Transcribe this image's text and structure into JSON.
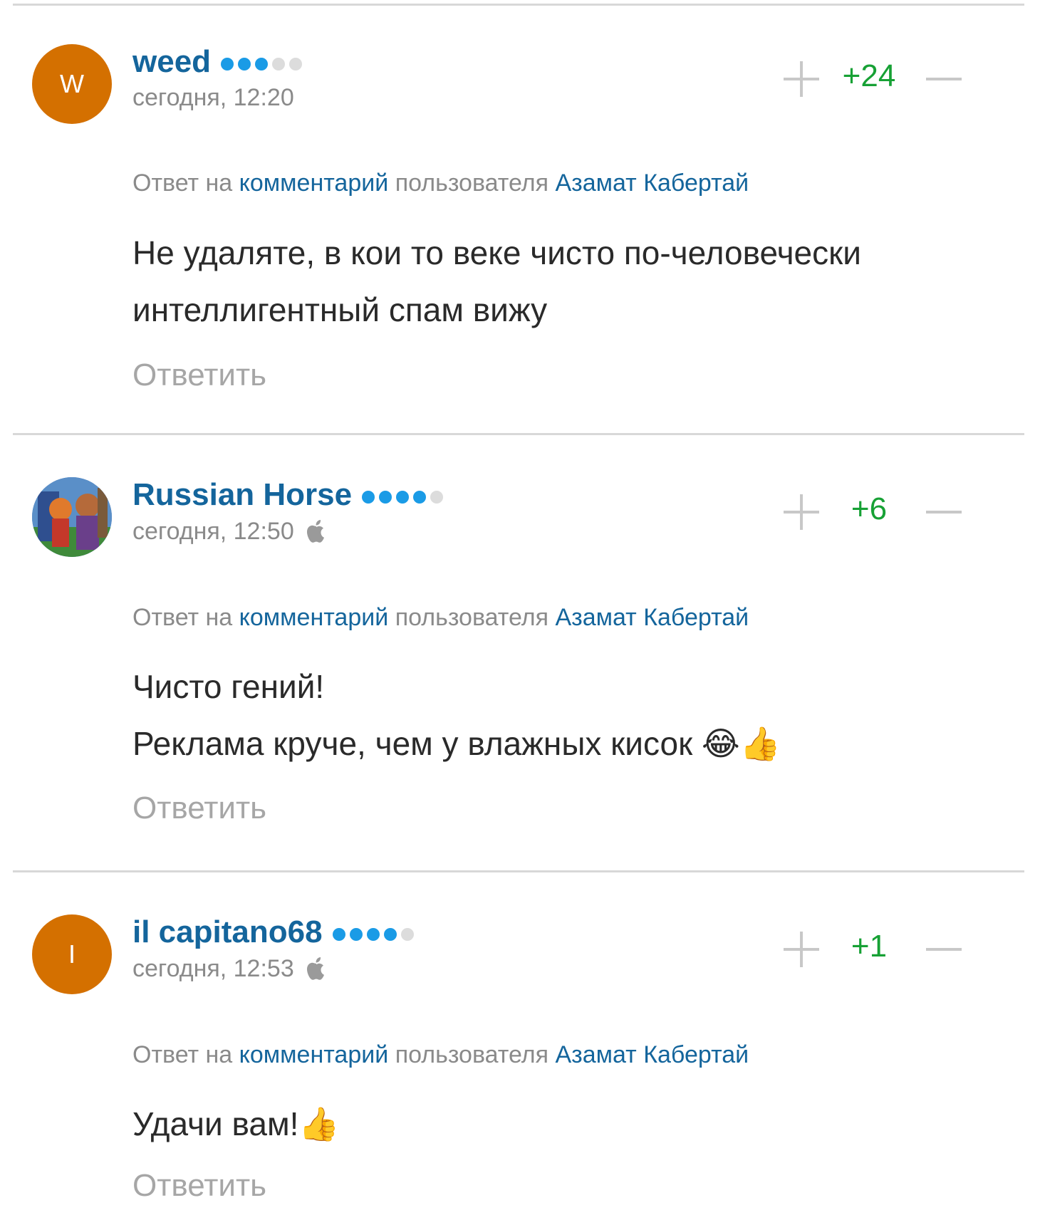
{
  "comments": [
    {
      "avatar_letter": "W",
      "author": "weed",
      "rating_filled": 3,
      "rating_total": 5,
      "timestamp": "сегодня, 12:20",
      "score": "+24",
      "reply_prefix": "Ответ на",
      "reply_link": "комментарий",
      "reply_mid": "пользователя",
      "reply_user": "Азамат Кабертай",
      "lines": [
        "Не удаляте, в кои то веке чисто по-человечески интеллигентный спам вижу"
      ],
      "reply_label": "Ответить"
    },
    {
      "avatar_letter": "",
      "author": "Russian Horse",
      "rating_filled": 4,
      "rating_total": 5,
      "timestamp": "сегодня, 12:50",
      "device_icon": "apple-icon",
      "score": "+6",
      "reply_prefix": "Ответ на",
      "reply_link": "комментарий",
      "reply_mid": "пользователя",
      "reply_user": "Азамат Кабертай",
      "lines": [
        "Чисто гений!",
        "Реклама круче, чем у влажных кисок"
      ],
      "emoji": "😂👍",
      "reply_label": "Ответить"
    },
    {
      "avatar_letter": "I",
      "author": "il capitano68",
      "rating_filled": 4,
      "rating_total": 5,
      "timestamp": "сегодня, 12:53",
      "device_icon": "apple-icon",
      "score": "+1",
      "reply_prefix": "Ответ на",
      "reply_link": "комментарий",
      "reply_mid": "пользователя",
      "reply_user": "Азамат Кабертай",
      "lines": [
        "Удачи вам!"
      ],
      "emoji": "👍",
      "reply_label": "Ответить"
    }
  ],
  "colors": {
    "link": "#14659c",
    "score": "#17a135",
    "muted": "#8a8a8a",
    "avatar_bg": "#d47000",
    "dot_on": "#1a9be6"
  }
}
